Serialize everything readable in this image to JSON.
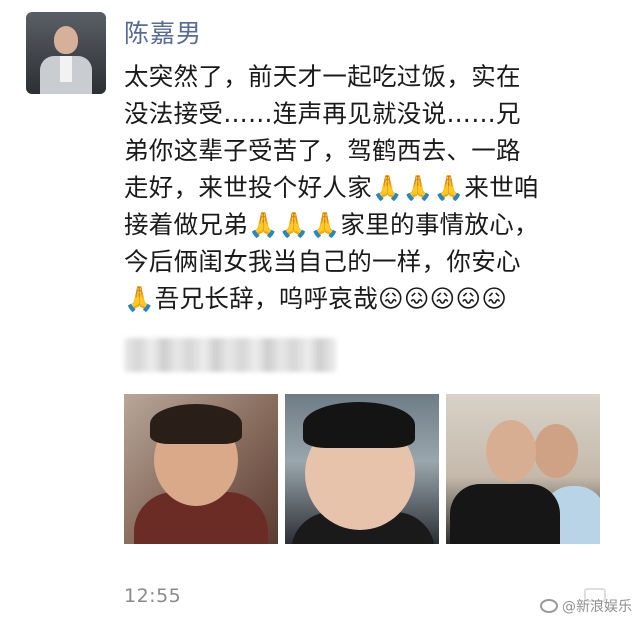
{
  "post": {
    "author": "陈嘉男",
    "lines": [
      "太突然了，前天才一起吃过饭，实在",
      "没法接受……连声再见就没说……兄",
      "弟你这辈子受苦了，驾鹤西去、一路",
      "走好，来世投个好人家🙏🙏🙏来世咱",
      "接着做兄弟🙏🙏🙏家里的事情放心，",
      "今后俩闺女我当自己的一样，你安心",
      "🙏吾兄长辞，呜呼哀哉😖😖😖😖😖"
    ],
    "time": "12:55"
  },
  "watermark": {
    "text": "@新浪娱乐"
  },
  "icons": {
    "watermark": "weibo-icon",
    "more": "more-options-icon"
  }
}
